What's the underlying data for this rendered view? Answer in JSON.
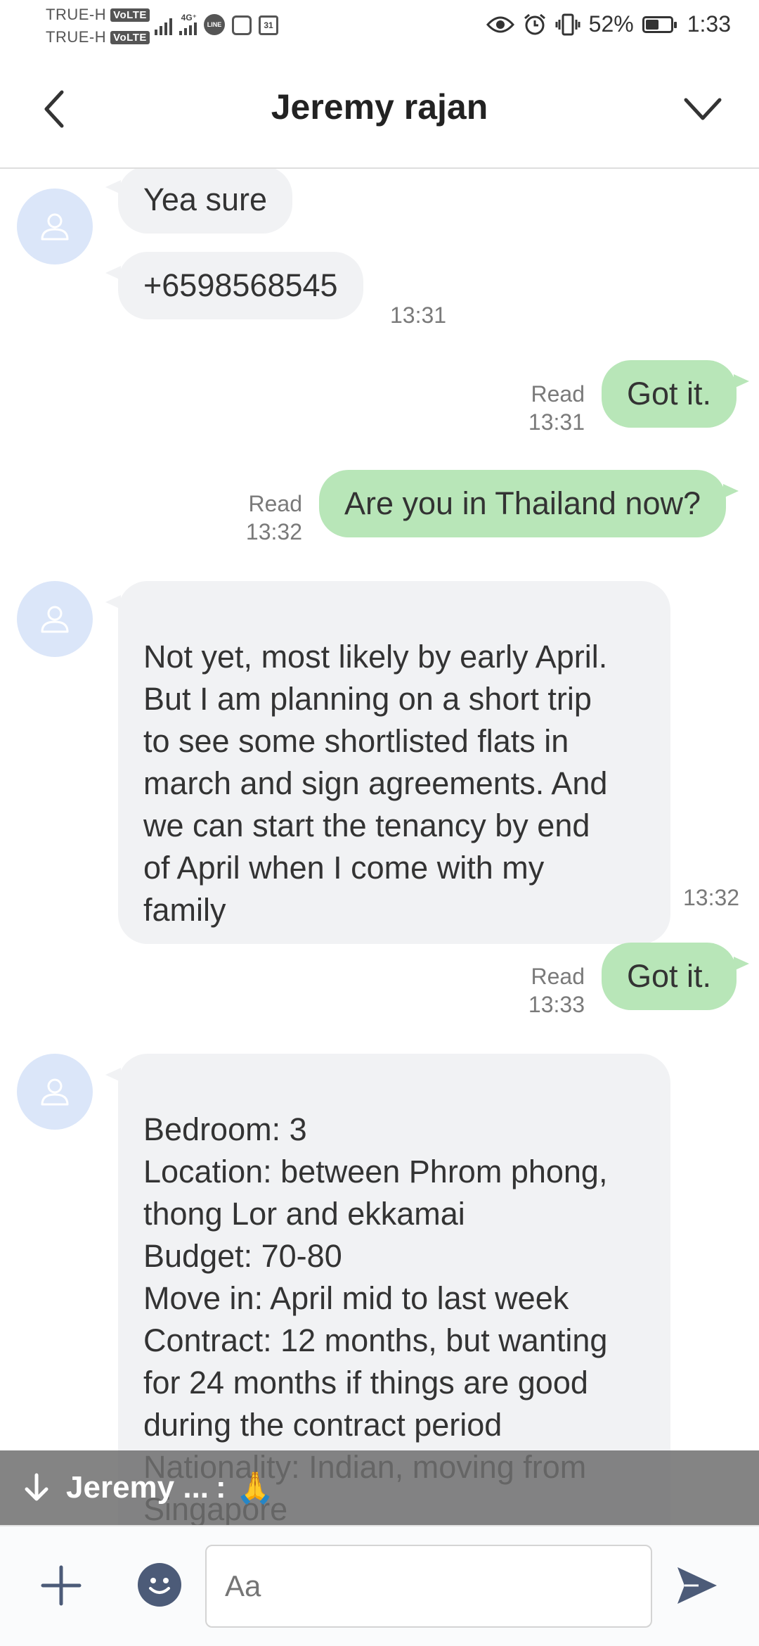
{
  "status_bar": {
    "carrier_1": "TRUE-H",
    "carrier_2": "TRUE-H",
    "volte_label": "VoLTE",
    "network_type": "4G⁺",
    "battery_percent": "52%",
    "battery_level": 0.52,
    "time": "1:33",
    "calendar_day": "31",
    "line_label": "LINE"
  },
  "header": {
    "title": "Jeremy rajan"
  },
  "messages": [
    {
      "text": "Yea sure"
    },
    {
      "text": "+6598568545",
      "time": "13:31"
    },
    {
      "text": "Got it.",
      "read": "Read",
      "time": "13:31"
    },
    {
      "text": "Are you in Thailand now?",
      "read": "Read",
      "time": "13:32"
    },
    {
      "text": "Not yet, most likely by early April.\nBut I am planning on a short trip\nto see some shortlisted flats in\nmarch and sign agreements. And\nwe can start the tenancy by end\nof April when I come with my\nfamily",
      "time": "13:32"
    },
    {
      "text": "Got it.",
      "read": "Read",
      "time": "13:33"
    },
    {
      "text": "Bedroom: 3\nLocation: between Phrom phong,\nthong Lor and ekkamai\nBudget: 70-80\nMove in: April mid to last week\nContract: 12 months, but wanting\nfor 24 months if things are good\nduring the contract period\nNationality: Indian, moving from\nSingapore\nPets: no preference so far"
    }
  ],
  "notification": {
    "sender": "Jeremy ...",
    "separator": ":",
    "emoji": "🙏"
  },
  "input": {
    "placeholder": "Aa"
  },
  "colors": {
    "incoming_bubble": "#f1f2f4",
    "outgoing_bubble": "#b8e6b8",
    "avatar_bg": "#dbe6f9",
    "icon_dark": "#4c5b78"
  },
  "icons": {
    "back": "back-arrow-icon",
    "menu": "chevron-down-icon",
    "avatar": "person-icon",
    "plus": "plus-icon",
    "emoji": "emoji-icon",
    "send": "send-icon",
    "scroll_down": "arrow-down-icon"
  }
}
